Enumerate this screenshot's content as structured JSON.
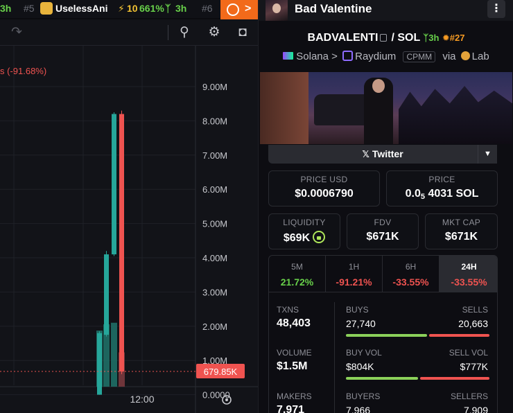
{
  "ticker": {
    "partial_age": "3h",
    "rank": "#5",
    "name": "UselessAni",
    "boost": "10",
    "change": "661%",
    "age": "3h",
    "next_rank_partial": "#6"
  },
  "fire_button": {
    "icon": "fire-icon",
    "arrow": ">"
  },
  "toolbar": {
    "icons": [
      "redo-icon",
      "indicator-icon",
      "settings-gear-icon",
      "camera-icon"
    ]
  },
  "chart": {
    "legend_change": "s (-91.68%)",
    "last_price_label": "679.85K",
    "time_label": "12:00",
    "colors": {
      "up": "#26a69a",
      "down": "#ef5350",
      "grid": "#1f2127",
      "axis_text": "#c9cacf"
    }
  },
  "chart_data": {
    "type": "candlestick",
    "y_axis_ticks": [
      "9.00M",
      "8.00M",
      "7.00M",
      "6.00M",
      "5.00M",
      "4.00M",
      "3.00M",
      "2.00M",
      "1.00M",
      "0.0000"
    ],
    "ylim": [
      0,
      9000000
    ],
    "last_price": 679850,
    "x_tick_labels": [
      "12:00"
    ],
    "candles": [
      {
        "open": 0,
        "close": 1800000,
        "high": 1850000,
        "low": 0,
        "dir": "up"
      },
      {
        "open": 1750000,
        "close": 4100000,
        "high": 4200000,
        "low": 1700000,
        "dir": "up"
      },
      {
        "open": 4100000,
        "close": 8200000,
        "high": 8250000,
        "low": 4050000,
        "dir": "up"
      },
      {
        "open": 8200000,
        "close": 679850,
        "high": 8300000,
        "low": 600000,
        "dir": "down"
      }
    ],
    "volume": [
      {
        "value": 1800000,
        "dir": "up"
      },
      {
        "value": 2000000,
        "dir": "up"
      },
      {
        "value": 2050000,
        "dir": "up"
      },
      {
        "value": 1100000,
        "dir": "down"
      }
    ]
  },
  "header": {
    "title": "Bad Valentine",
    "menu": "⋮"
  },
  "pair": {
    "base": "BADVALENTI",
    "separator": "/",
    "quote": "SOL",
    "age": "3h",
    "rank": "#27"
  },
  "chain": {
    "chain": "Solana",
    "arrow": ">",
    "dex": "Raydium",
    "pool_type": "CPMM",
    "via": "via",
    "launchpad": "Lab"
  },
  "twitter": {
    "label": "Twitter",
    "icon": "x-logo-icon"
  },
  "prices": {
    "price_usd_label": "PRICE USD",
    "price_usd": "$0.0006790",
    "price_sol_label": "PRICE",
    "price_sol_prefix": "0.0",
    "price_sol_sub": "5",
    "price_sol_suffix": "4031 SOL"
  },
  "metrics": {
    "liquidity_label": "LIQUIDITY",
    "liquidity": "$69K",
    "fdv_label": "FDV",
    "fdv": "$671K",
    "mcap_label": "MKT CAP",
    "mcap": "$671K"
  },
  "timeframes": [
    {
      "label": "5M",
      "value": "21.72%",
      "dir": "pos"
    },
    {
      "label": "1H",
      "value": "-91.21%",
      "dir": "neg"
    },
    {
      "label": "6H",
      "value": "-33.55%",
      "dir": "neg"
    },
    {
      "label": "24H",
      "value": "-33.55%",
      "dir": "neg",
      "active": true
    }
  ],
  "stats": {
    "txns_label": "TXNS",
    "txns": "48,403",
    "buys_label": "BUYS",
    "buys": "27,740",
    "sells_label": "SELLS",
    "sells": "20,663",
    "buys_share": 0.573,
    "volume_label": "VOLUME",
    "volume": "$1.5M",
    "buy_vol_label": "BUY VOL",
    "buy_vol": "$804K",
    "sell_vol_label": "SELL VOL",
    "sell_vol": "$777K",
    "buy_vol_share": 0.508,
    "makers_label": "MAKERS",
    "makers": "7,971",
    "buyers_label": "BUYERS",
    "buyers": "7,966",
    "sellers_label": "SELLERS",
    "sellers": "7,909"
  }
}
